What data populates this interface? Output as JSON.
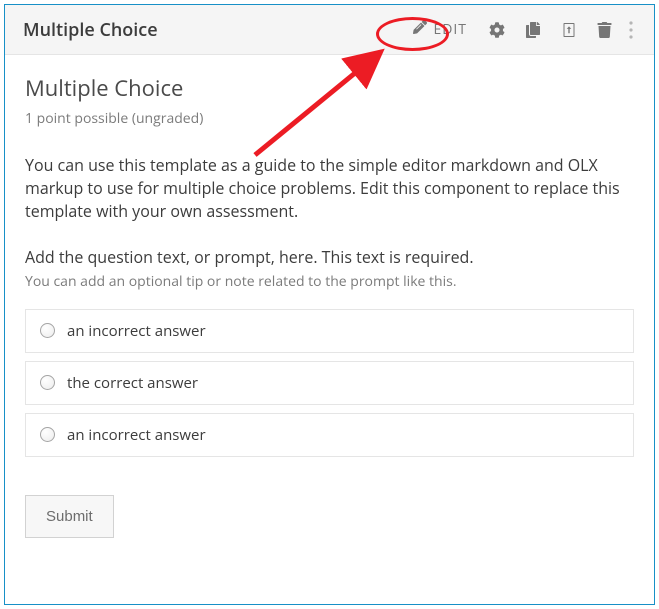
{
  "header": {
    "title": "Multiple Choice",
    "edit_label": "EDIT"
  },
  "problem": {
    "title": "Multiple Choice",
    "points_text": "1 point possible (ungraded)",
    "intro": "You can use this template as a guide to the simple editor markdown and OLX markup to use for multiple choice problems. Edit this component to replace this template with your own assessment.",
    "prompt": "Add the question text, or prompt, here. This text is required.",
    "tip": "You can add an optional tip or note related to the prompt like this.",
    "choices": [
      {
        "label": "an incorrect answer"
      },
      {
        "label": "the correct answer"
      },
      {
        "label": "an incorrect answer"
      }
    ],
    "submit_label": "Submit"
  }
}
